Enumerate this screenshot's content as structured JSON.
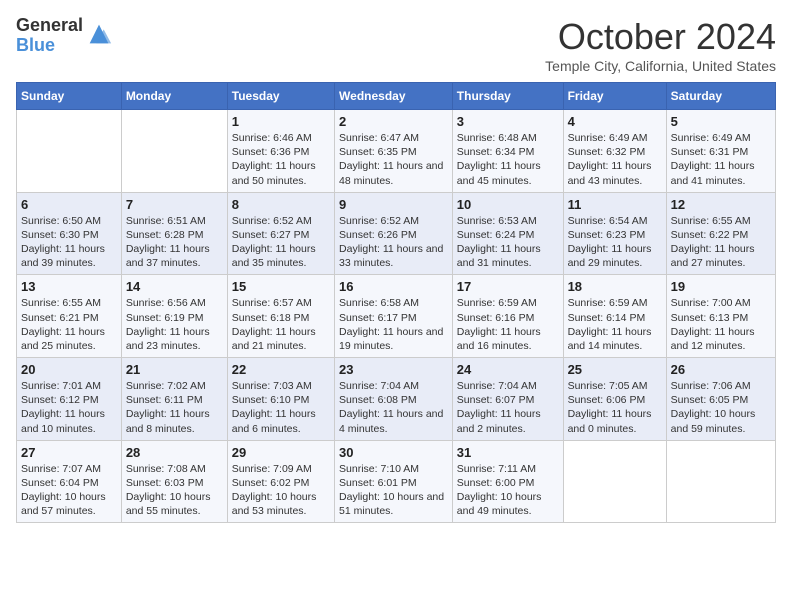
{
  "logo": {
    "line1": "General",
    "line2": "Blue"
  },
  "title": "October 2024",
  "location": "Temple City, California, United States",
  "days_header": [
    "Sunday",
    "Monday",
    "Tuesday",
    "Wednesday",
    "Thursday",
    "Friday",
    "Saturday"
  ],
  "weeks": [
    [
      {
        "day": "",
        "sunrise": "",
        "sunset": "",
        "daylight": ""
      },
      {
        "day": "",
        "sunrise": "",
        "sunset": "",
        "daylight": ""
      },
      {
        "day": "1",
        "sunrise": "Sunrise: 6:46 AM",
        "sunset": "Sunset: 6:36 PM",
        "daylight": "Daylight: 11 hours and 50 minutes."
      },
      {
        "day": "2",
        "sunrise": "Sunrise: 6:47 AM",
        "sunset": "Sunset: 6:35 PM",
        "daylight": "Daylight: 11 hours and 48 minutes."
      },
      {
        "day": "3",
        "sunrise": "Sunrise: 6:48 AM",
        "sunset": "Sunset: 6:34 PM",
        "daylight": "Daylight: 11 hours and 45 minutes."
      },
      {
        "day": "4",
        "sunrise": "Sunrise: 6:49 AM",
        "sunset": "Sunset: 6:32 PM",
        "daylight": "Daylight: 11 hours and 43 minutes."
      },
      {
        "day": "5",
        "sunrise": "Sunrise: 6:49 AM",
        "sunset": "Sunset: 6:31 PM",
        "daylight": "Daylight: 11 hours and 41 minutes."
      }
    ],
    [
      {
        "day": "6",
        "sunrise": "Sunrise: 6:50 AM",
        "sunset": "Sunset: 6:30 PM",
        "daylight": "Daylight: 11 hours and 39 minutes."
      },
      {
        "day": "7",
        "sunrise": "Sunrise: 6:51 AM",
        "sunset": "Sunset: 6:28 PM",
        "daylight": "Daylight: 11 hours and 37 minutes."
      },
      {
        "day": "8",
        "sunrise": "Sunrise: 6:52 AM",
        "sunset": "Sunset: 6:27 PM",
        "daylight": "Daylight: 11 hours and 35 minutes."
      },
      {
        "day": "9",
        "sunrise": "Sunrise: 6:52 AM",
        "sunset": "Sunset: 6:26 PM",
        "daylight": "Daylight: 11 hours and 33 minutes."
      },
      {
        "day": "10",
        "sunrise": "Sunrise: 6:53 AM",
        "sunset": "Sunset: 6:24 PM",
        "daylight": "Daylight: 11 hours and 31 minutes."
      },
      {
        "day": "11",
        "sunrise": "Sunrise: 6:54 AM",
        "sunset": "Sunset: 6:23 PM",
        "daylight": "Daylight: 11 hours and 29 minutes."
      },
      {
        "day": "12",
        "sunrise": "Sunrise: 6:55 AM",
        "sunset": "Sunset: 6:22 PM",
        "daylight": "Daylight: 11 hours and 27 minutes."
      }
    ],
    [
      {
        "day": "13",
        "sunrise": "Sunrise: 6:55 AM",
        "sunset": "Sunset: 6:21 PM",
        "daylight": "Daylight: 11 hours and 25 minutes."
      },
      {
        "day": "14",
        "sunrise": "Sunrise: 6:56 AM",
        "sunset": "Sunset: 6:19 PM",
        "daylight": "Daylight: 11 hours and 23 minutes."
      },
      {
        "day": "15",
        "sunrise": "Sunrise: 6:57 AM",
        "sunset": "Sunset: 6:18 PM",
        "daylight": "Daylight: 11 hours and 21 minutes."
      },
      {
        "day": "16",
        "sunrise": "Sunrise: 6:58 AM",
        "sunset": "Sunset: 6:17 PM",
        "daylight": "Daylight: 11 hours and 19 minutes."
      },
      {
        "day": "17",
        "sunrise": "Sunrise: 6:59 AM",
        "sunset": "Sunset: 6:16 PM",
        "daylight": "Daylight: 11 hours and 16 minutes."
      },
      {
        "day": "18",
        "sunrise": "Sunrise: 6:59 AM",
        "sunset": "Sunset: 6:14 PM",
        "daylight": "Daylight: 11 hours and 14 minutes."
      },
      {
        "day": "19",
        "sunrise": "Sunrise: 7:00 AM",
        "sunset": "Sunset: 6:13 PM",
        "daylight": "Daylight: 11 hours and 12 minutes."
      }
    ],
    [
      {
        "day": "20",
        "sunrise": "Sunrise: 7:01 AM",
        "sunset": "Sunset: 6:12 PM",
        "daylight": "Daylight: 11 hours and 10 minutes."
      },
      {
        "day": "21",
        "sunrise": "Sunrise: 7:02 AM",
        "sunset": "Sunset: 6:11 PM",
        "daylight": "Daylight: 11 hours and 8 minutes."
      },
      {
        "day": "22",
        "sunrise": "Sunrise: 7:03 AM",
        "sunset": "Sunset: 6:10 PM",
        "daylight": "Daylight: 11 hours and 6 minutes."
      },
      {
        "day": "23",
        "sunrise": "Sunrise: 7:04 AM",
        "sunset": "Sunset: 6:08 PM",
        "daylight": "Daylight: 11 hours and 4 minutes."
      },
      {
        "day": "24",
        "sunrise": "Sunrise: 7:04 AM",
        "sunset": "Sunset: 6:07 PM",
        "daylight": "Daylight: 11 hours and 2 minutes."
      },
      {
        "day": "25",
        "sunrise": "Sunrise: 7:05 AM",
        "sunset": "Sunset: 6:06 PM",
        "daylight": "Daylight: 11 hours and 0 minutes."
      },
      {
        "day": "26",
        "sunrise": "Sunrise: 7:06 AM",
        "sunset": "Sunset: 6:05 PM",
        "daylight": "Daylight: 10 hours and 59 minutes."
      }
    ],
    [
      {
        "day": "27",
        "sunrise": "Sunrise: 7:07 AM",
        "sunset": "Sunset: 6:04 PM",
        "daylight": "Daylight: 10 hours and 57 minutes."
      },
      {
        "day": "28",
        "sunrise": "Sunrise: 7:08 AM",
        "sunset": "Sunset: 6:03 PM",
        "daylight": "Daylight: 10 hours and 55 minutes."
      },
      {
        "day": "29",
        "sunrise": "Sunrise: 7:09 AM",
        "sunset": "Sunset: 6:02 PM",
        "daylight": "Daylight: 10 hours and 53 minutes."
      },
      {
        "day": "30",
        "sunrise": "Sunrise: 7:10 AM",
        "sunset": "Sunset: 6:01 PM",
        "daylight": "Daylight: 10 hours and 51 minutes."
      },
      {
        "day": "31",
        "sunrise": "Sunrise: 7:11 AM",
        "sunset": "Sunset: 6:00 PM",
        "daylight": "Daylight: 10 hours and 49 minutes."
      },
      {
        "day": "",
        "sunrise": "",
        "sunset": "",
        "daylight": ""
      },
      {
        "day": "",
        "sunrise": "",
        "sunset": "",
        "daylight": ""
      }
    ]
  ]
}
